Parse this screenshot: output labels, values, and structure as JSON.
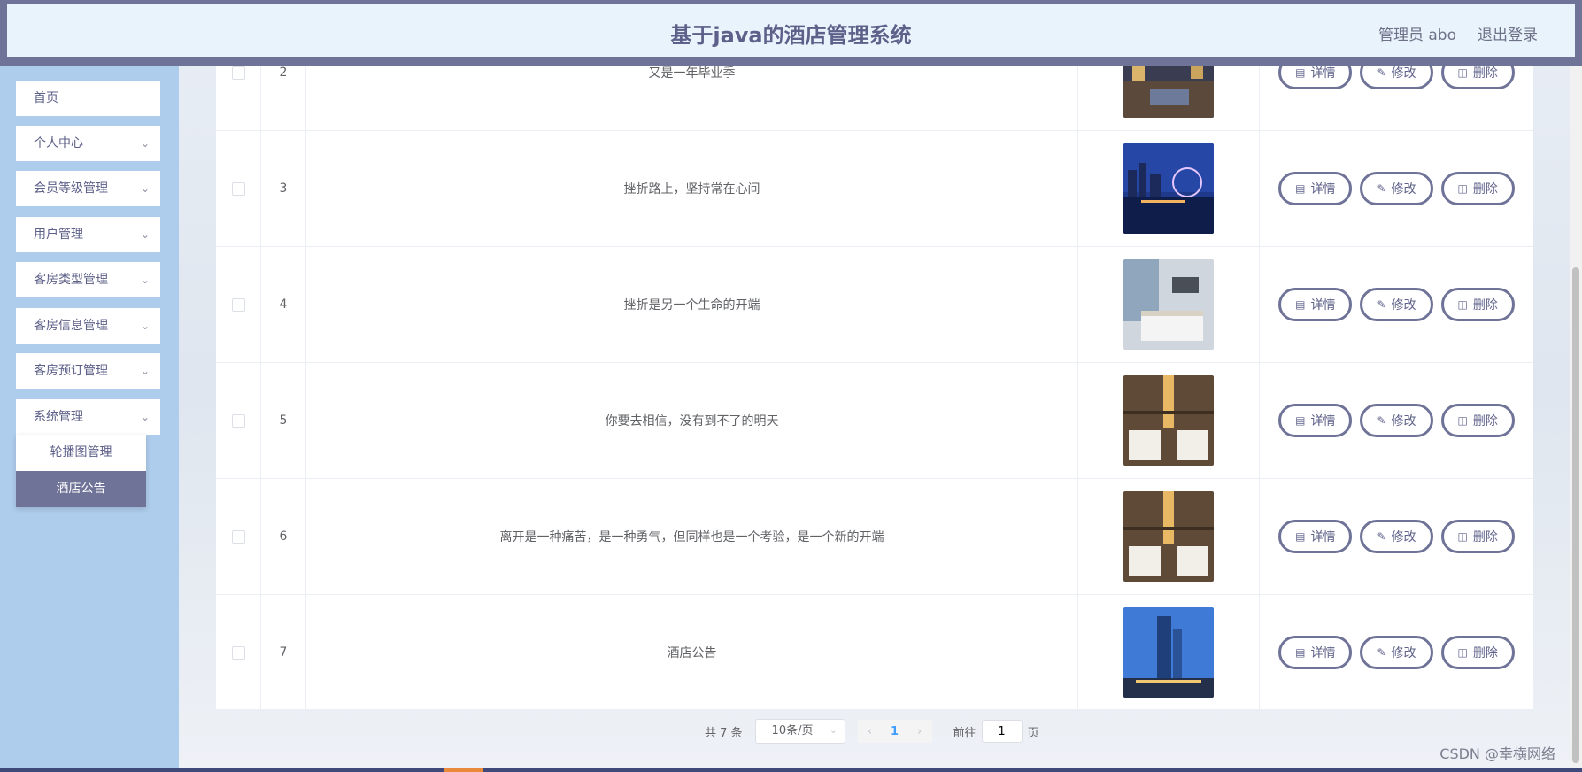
{
  "header": {
    "title": "基于java的酒店管理系统",
    "user_label": "管理员 abo",
    "logout_label": "退出登录"
  },
  "sidebar": {
    "items": [
      {
        "label": "首页",
        "has_children": false
      },
      {
        "label": "个人中心",
        "has_children": true
      },
      {
        "label": "会员等级管理",
        "has_children": true
      },
      {
        "label": "用户管理",
        "has_children": true
      },
      {
        "label": "客房类型管理",
        "has_children": true
      },
      {
        "label": "客房信息管理",
        "has_children": true
      },
      {
        "label": "客房预订管理",
        "has_children": true
      },
      {
        "label": "系统管理",
        "has_children": true
      }
    ],
    "submenu": [
      {
        "label": "轮播图管理",
        "active": false
      },
      {
        "label": "酒店公告",
        "active": true
      }
    ]
  },
  "table": {
    "rows": [
      {
        "index": "2",
        "title": "又是一年毕业季",
        "image": "hotel-lobby-photo"
      },
      {
        "index": "3",
        "title": "挫折路上，坚持常在心间",
        "image": "city-night-skyline-photo"
      },
      {
        "index": "4",
        "title": "挫折是另一个生命的开端",
        "image": "hotel-room-window-photo"
      },
      {
        "index": "5",
        "title": "你要去相信，没有到不了的明天",
        "image": "twin-bed-room-photo"
      },
      {
        "index": "6",
        "title": "离开是一种痛苦，是一种勇气，但同样也是一个考验，是一个新的开端",
        "image": "twin-bed-room-photo"
      },
      {
        "index": "7",
        "title": "酒店公告",
        "image": "hotel-tower-exterior-photo"
      }
    ],
    "actions": {
      "detail": "详情",
      "edit": "修改",
      "delete": "删除"
    }
  },
  "pagination": {
    "total": "共 7 条",
    "page_size": "10条/页",
    "current_page": "1",
    "goto_label": "前往",
    "goto_value": "1",
    "page_suffix": "页"
  },
  "watermark": "CSDN @幸横网络",
  "colors": {
    "accent": "#6f7397",
    "sidebar_bg": "#aeccec",
    "header_bg": "#e8f3fc"
  }
}
